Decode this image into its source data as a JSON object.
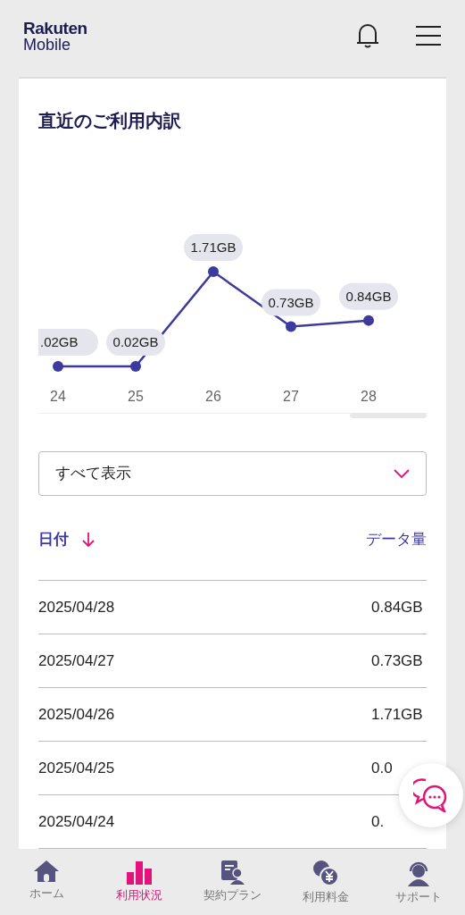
{
  "header": {
    "logo_top": "Rakuten",
    "logo_bottom": "Mobile"
  },
  "section": {
    "title": "直近のご利用内訳",
    "chart_data": {
      "type": "line",
      "categories": [
        "24",
        "25",
        "26",
        "27",
        "28"
      ],
      "series": [
        {
          "color": "#3d3a9e",
          "marker": "circle",
          "values": [
            0.02,
            0.02,
            1.71,
            0.73,
            0.84
          ],
          "value_labels": [
            ".02GB",
            "0.02GB",
            "1.71GB",
            "0.73GB",
            "0.84GB"
          ]
        }
      ]
    },
    "filter": {
      "value": "すべて表示"
    },
    "table": {
      "columns": [
        "日付",
        "データ量"
      ],
      "rows": [
        {
          "date": "2025/04/28",
          "amount": "0.84GB"
        },
        {
          "date": "2025/04/27",
          "amount": "0.73GB"
        },
        {
          "date": "2025/04/26",
          "amount": "1.71GB"
        },
        {
          "date": "2025/04/25",
          "amount": "0.0"
        },
        {
          "date": "2025/04/24",
          "amount": "0."
        }
      ]
    }
  },
  "bottom_nav": [
    {
      "label": "ホーム",
      "kind": "home",
      "selected": false
    },
    {
      "label": "利用状況",
      "kind": "bars",
      "selected": true
    },
    {
      "label": "契約プラン",
      "kind": "plan",
      "selected": false
    },
    {
      "label": "利用料金",
      "kind": "fee",
      "selected": false
    },
    {
      "label": "サポート",
      "kind": "support",
      "selected": false
    }
  ]
}
